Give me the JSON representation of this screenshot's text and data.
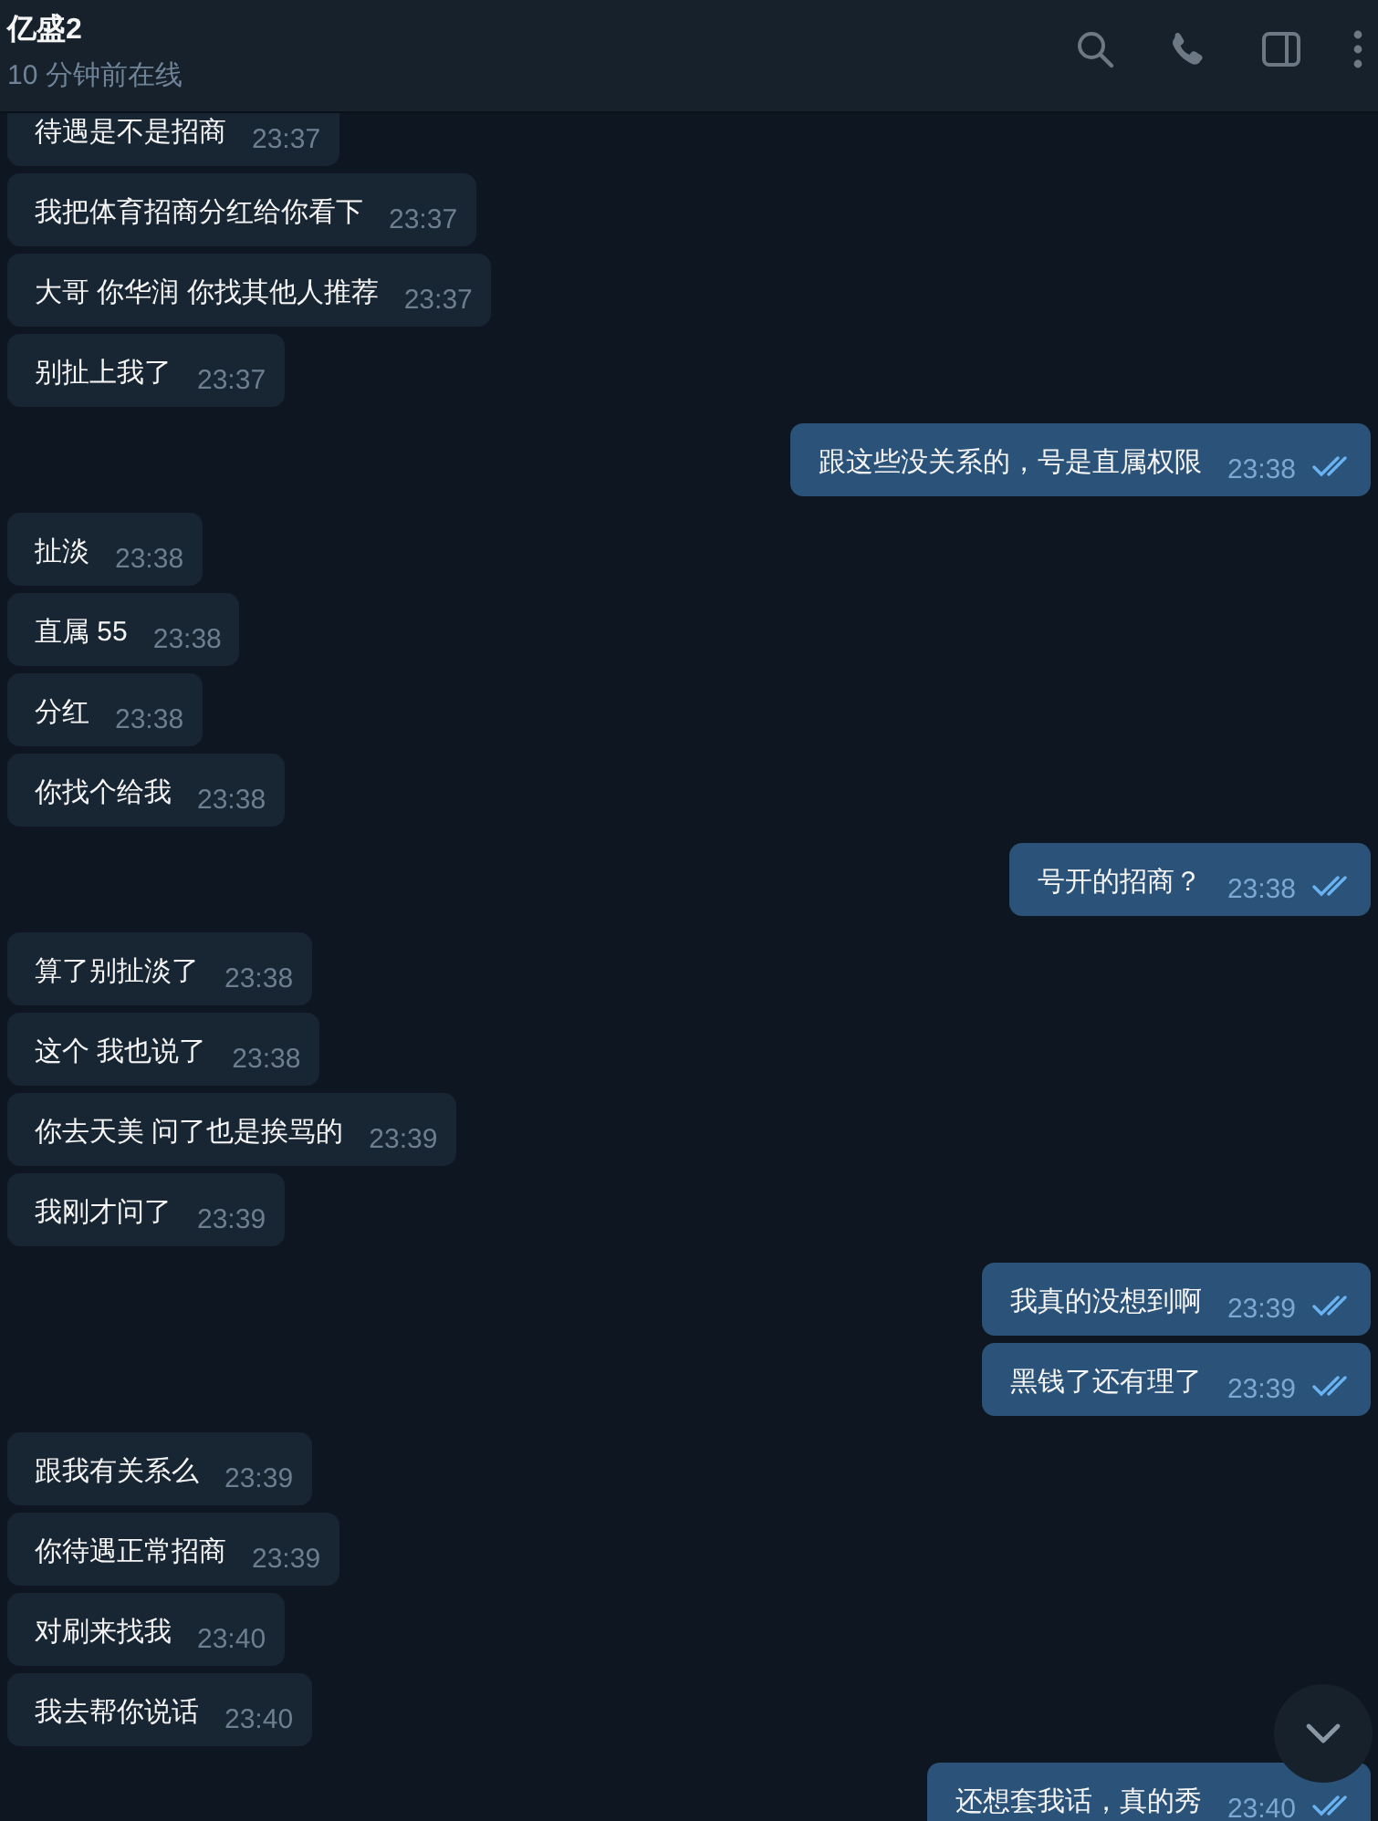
{
  "header": {
    "title": "亿盛2",
    "status": "10 分钟前在线"
  },
  "groups": [
    {
      "kind": "in",
      "messages": [
        {
          "text": "待遇是不是招商",
          "time": "23:37"
        },
        {
          "text": "我把体育招商分红给你看下",
          "time": "23:37"
        },
        {
          "text": "大哥 你华润 你找其他人推荐",
          "time": "23:37"
        },
        {
          "text": "别扯上我了",
          "time": "23:37"
        }
      ]
    },
    {
      "kind": "out",
      "messages": [
        {
          "text": "跟这些没关系的，号是直属权限",
          "time": "23:38",
          "read": true
        }
      ]
    },
    {
      "kind": "in",
      "messages": [
        {
          "text": "扯淡",
          "time": "23:38"
        },
        {
          "text": "直属 55",
          "time": "23:38"
        },
        {
          "text": "分红",
          "time": "23:38"
        },
        {
          "text": "你找个给我",
          "time": "23:38"
        }
      ]
    },
    {
      "kind": "out",
      "messages": [
        {
          "text": "号开的招商？",
          "time": "23:38",
          "read": true
        }
      ]
    },
    {
      "kind": "in",
      "messages": [
        {
          "text": "算了别扯淡了",
          "time": "23:38"
        },
        {
          "text": "这个 我也说了",
          "time": "23:38"
        },
        {
          "text": "你去天美 问了也是挨骂的",
          "time": "23:39"
        },
        {
          "text": "我刚才问了",
          "time": "23:39"
        }
      ]
    },
    {
      "kind": "out",
      "messages": [
        {
          "text": "我真的没想到啊",
          "time": "23:39",
          "read": true
        },
        {
          "text": "黑钱了还有理了",
          "time": "23:39",
          "read": true
        }
      ]
    },
    {
      "kind": "in",
      "messages": [
        {
          "text": "跟我有关系么",
          "time": "23:39"
        },
        {
          "text": "你待遇正常招商",
          "time": "23:39"
        },
        {
          "text": "对刷来找我",
          "time": "23:40"
        },
        {
          "text": "我去帮你说话",
          "time": "23:40"
        }
      ]
    },
    {
      "kind": "out",
      "messages": [
        {
          "text": "还想套我话，真的秀",
          "time": "23:40",
          "read": true
        }
      ]
    }
  ]
}
